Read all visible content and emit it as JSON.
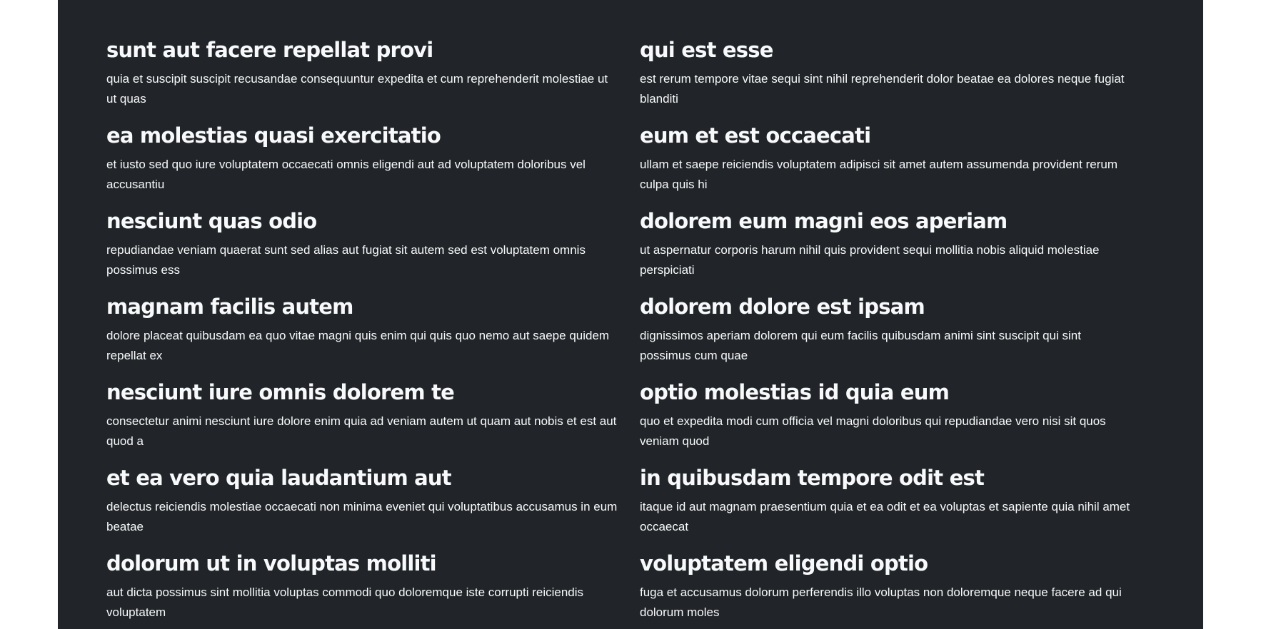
{
  "posts": [
    {
      "title": "sunt aut facere repellat provi",
      "body": "quia et suscipit suscipit recusandae consequuntur expedita et cum reprehenderit molestiae ut ut quas"
    },
    {
      "title": "qui est esse",
      "body": "est rerum tempore vitae sequi sint nihil reprehenderit dolor beatae ea dolores neque fugiat blanditi"
    },
    {
      "title": "ea molestias quasi exercitatio",
      "body": "et iusto sed quo iure voluptatem occaecati omnis eligendi aut ad voluptatem doloribus vel accusantiu"
    },
    {
      "title": "eum et est occaecati",
      "body": "ullam et saepe reiciendis voluptatem adipisci sit amet autem assumenda provident rerum culpa quis hi"
    },
    {
      "title": "nesciunt quas odio",
      "body": "repudiandae veniam quaerat sunt sed alias aut fugiat sit autem sed est voluptatem omnis possimus ess"
    },
    {
      "title": "dolorem eum magni eos aperiam",
      "body": "ut aspernatur corporis harum nihil quis provident sequi mollitia nobis aliquid molestiae perspiciati"
    },
    {
      "title": "magnam facilis autem",
      "body": "dolore placeat quibusdam ea quo vitae magni quis enim qui quis quo nemo aut saepe quidem repellat ex"
    },
    {
      "title": "dolorem dolore est ipsam",
      "body": "dignissimos aperiam dolorem qui eum facilis quibusdam animi sint suscipit qui sint possimus cum quae"
    },
    {
      "title": "nesciunt iure omnis dolorem te",
      "body": "consectetur animi nesciunt iure dolore enim quia ad veniam autem ut quam aut nobis et est aut quod a"
    },
    {
      "title": "optio molestias id quia eum",
      "body": "quo et expedita modi cum officia vel magni doloribus qui repudiandae vero nisi sit quos veniam quod"
    },
    {
      "title": "et ea vero quia laudantium aut",
      "body": "delectus reiciendis molestiae occaecati non minima eveniet qui voluptatibus accusamus in eum beatae"
    },
    {
      "title": "in quibusdam tempore odit est",
      "body": "itaque id aut magnam praesentium quia et ea odit et ea voluptas et sapiente quia nihil amet occaecat"
    },
    {
      "title": "dolorum ut in voluptas molliti",
      "body": "aut dicta possimus sint mollitia voluptas commodi quo doloremque iste corrupti reiciendis voluptatem"
    },
    {
      "title": "voluptatem eligendi optio",
      "body": "fuga et accusamus dolorum perferendis illo voluptas non doloremque neque facere ad qui dolorum moles"
    }
  ],
  "theme": {
    "page_background": "#ffffff",
    "panel_background": "#212529",
    "text_color": "#f8f9fa"
  }
}
